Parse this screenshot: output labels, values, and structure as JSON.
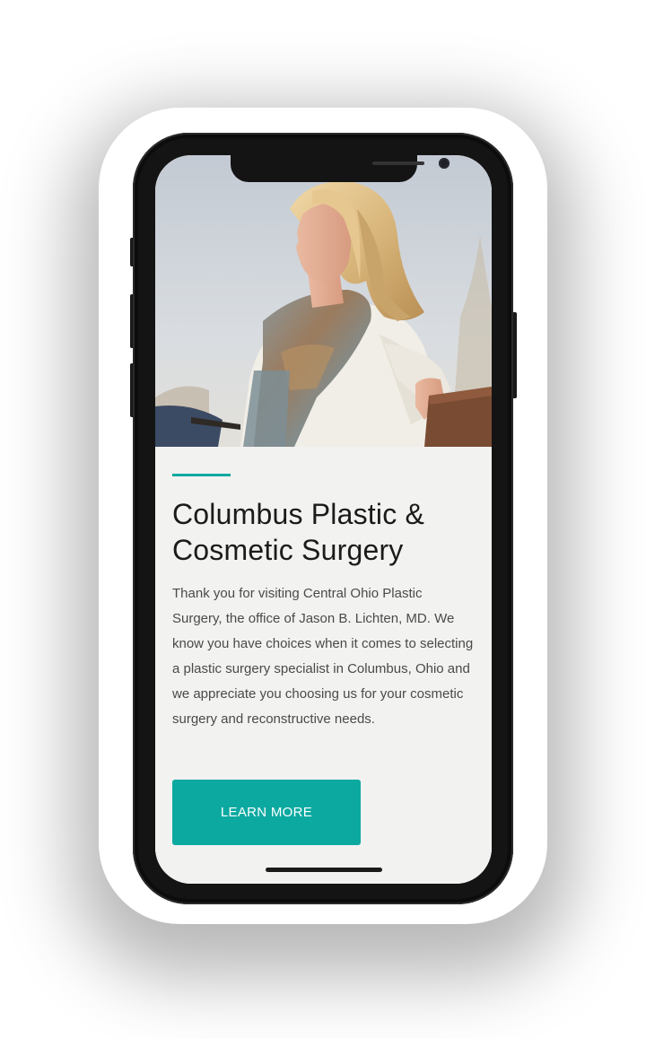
{
  "hero": {
    "image_description_icon": "woman-on-bench-photo"
  },
  "article": {
    "title": "Columbus Plastic & Cosmetic Surgery",
    "body": "Thank you for visiting Central Ohio Plastic Surgery, the office of Jason B. Lichten, MD. We know you have choices when it comes to selecting a plastic surgery specialist in Columbus, Ohio and we appreciate you choosing us for your cosmetic surgery and reconstructive needs.",
    "cta_label": "LEARN MORE"
  },
  "colors": {
    "accent": "#0ba9a0",
    "title_text": "#1b1b1b",
    "body_text": "#4a4a4a",
    "panel_bg": "#f2f2f0",
    "phone_frame": "#141414"
  }
}
